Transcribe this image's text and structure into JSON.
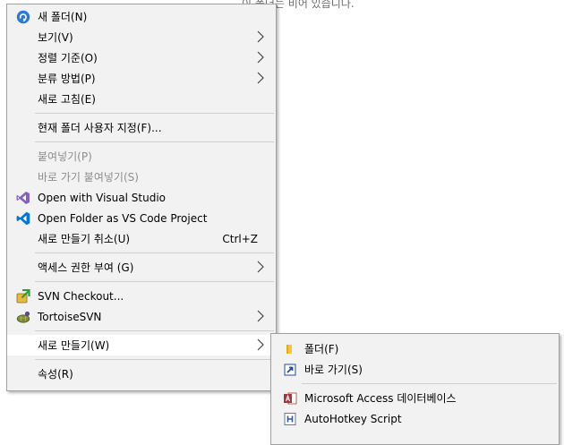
{
  "background": {
    "text": "이 폴더는 비어 있습니다."
  },
  "context_menu": {
    "items": [
      {
        "label": "새 폴더(N)",
        "icon": "new-folder-icon",
        "disabled": false,
        "submenu": false
      },
      {
        "label": "보기(V)",
        "disabled": false,
        "submenu": true
      },
      {
        "label": "정렬 기준(O)",
        "disabled": false,
        "submenu": true
      },
      {
        "label": "분류 방법(P)",
        "disabled": false,
        "submenu": true
      },
      {
        "label": "새로 고침(E)",
        "disabled": false,
        "submenu": false
      },
      {
        "label": "현재 폴더 사용자 지정(F)...",
        "disabled": false,
        "submenu": false
      },
      {
        "label": "붙여넣기(P)",
        "disabled": true,
        "submenu": false
      },
      {
        "label": "바로 가기 붙여넣기(S)",
        "disabled": true,
        "submenu": false
      },
      {
        "label": "Open with Visual Studio",
        "icon": "visual-studio-icon",
        "disabled": false,
        "submenu": false
      },
      {
        "label": "Open Folder as VS Code Project",
        "icon": "vscode-icon",
        "disabled": false,
        "submenu": false
      },
      {
        "label": "새로 만들기 취소(U)",
        "shortcut": "Ctrl+Z",
        "disabled": false,
        "submenu": false
      },
      {
        "label": "액세스 권한 부여 (G)",
        "disabled": false,
        "submenu": true
      },
      {
        "label": "SVN Checkout...",
        "icon": "svn-checkout-icon",
        "disabled": false,
        "submenu": false
      },
      {
        "label": "TortoiseSVN",
        "icon": "tortoisesvn-icon",
        "disabled": false,
        "submenu": true
      },
      {
        "label": "새로 만들기(W)",
        "disabled": false,
        "submenu": true,
        "highlighted": true
      },
      {
        "label": "속성(R)",
        "disabled": false,
        "submenu": false
      }
    ]
  },
  "new_submenu": {
    "items": [
      {
        "label": "폴더(F)",
        "icon": "folder-icon"
      },
      {
        "label": "바로 가기(S)",
        "icon": "shortcut-icon"
      },
      {
        "label": "Microsoft Access 데이터베이스",
        "icon": "access-icon"
      },
      {
        "label": "AutoHotkey Script",
        "icon": "autohotkey-icon"
      }
    ]
  },
  "colors": {
    "menu_bg": "#f2f2f2",
    "highlight_bg": "#ffffff",
    "disabled_text": "#8d8d8d",
    "separator": "#cfcfcf",
    "vs_purple": "#865fc5",
    "vscode_blue": "#0078d4",
    "access_red": "#a4373a",
    "folder_yellow": "#f8c43a"
  }
}
